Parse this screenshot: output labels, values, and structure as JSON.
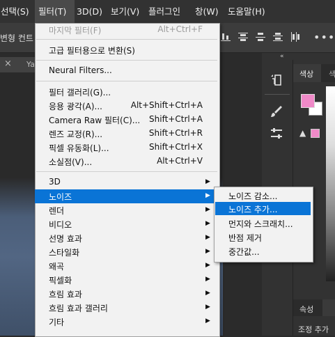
{
  "menubar": {
    "items": [
      {
        "label": "선택(S)"
      },
      {
        "label": "필터(T)"
      },
      {
        "label": "3D(D)"
      },
      {
        "label": "보기(V)"
      },
      {
        "label": "플러그인"
      },
      {
        "label": "창(W)"
      },
      {
        "label": "도움말(H)"
      }
    ]
  },
  "options": {
    "partial_text": "변형 컨트"
  },
  "tab": {
    "close": "×",
    "label": "Ya"
  },
  "panel": {
    "collapse": "«",
    "tab_color": "색상",
    "tab_second": "색",
    "bottom_tab": "속성",
    "bottom_row": "조정 추가"
  },
  "colors": {
    "foreground": "#f08ac8",
    "background": "#ffffff",
    "highlight": "#0a74d6"
  },
  "filter_menu": {
    "last_filter": {
      "label": "마지막 필터(F)",
      "shortcut": "Alt+Ctrl+F"
    },
    "convert_smart": {
      "label": "고급 필터용으로 변환(S)"
    },
    "neural": {
      "label": "Neural Filters..."
    },
    "gallery": {
      "label": "필터 갤러리(G)..."
    },
    "wide_angle": {
      "label": "응용 광각(A)...",
      "shortcut": "Alt+Shift+Ctrl+A"
    },
    "camera_raw": {
      "label": "Camera Raw 필터(C)...",
      "shortcut": "Shift+Ctrl+A"
    },
    "lens": {
      "label": "렌즈 교정(R)...",
      "shortcut": "Shift+Ctrl+R"
    },
    "liquify": {
      "label": "픽셀 유동화(L)...",
      "shortcut": "Shift+Ctrl+X"
    },
    "vanishing": {
      "label": "소실점(V)...",
      "shortcut": "Alt+Ctrl+V"
    },
    "submenus": [
      {
        "label": "3D"
      },
      {
        "label": "노이즈"
      },
      {
        "label": "렌더"
      },
      {
        "label": "비디오"
      },
      {
        "label": "선명 효과"
      },
      {
        "label": "스타일화"
      },
      {
        "label": "왜곡"
      },
      {
        "label": "픽셀화"
      },
      {
        "label": "흐림 효과"
      },
      {
        "label": "흐림 효과 갤러리"
      },
      {
        "label": "기타"
      }
    ],
    "arrow": "▶"
  },
  "noise_submenu": {
    "items": [
      {
        "label": "노이즈 감소..."
      },
      {
        "label": "노이즈 추가..."
      },
      {
        "label": "먼지와 스크래치..."
      },
      {
        "label": "반점 제거"
      },
      {
        "label": "중간값..."
      }
    ]
  }
}
